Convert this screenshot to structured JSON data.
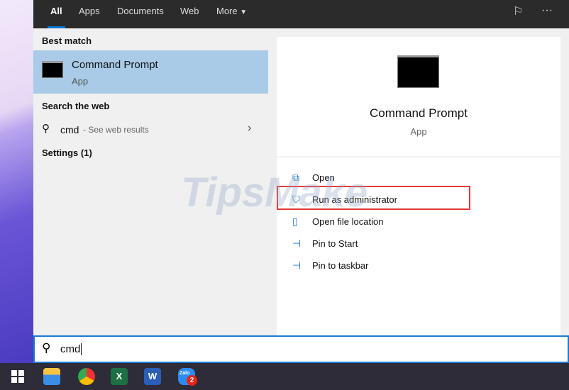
{
  "tabs": [
    {
      "label": "All",
      "active": true
    },
    {
      "label": "Apps"
    },
    {
      "label": "Documents"
    },
    {
      "label": "Web"
    },
    {
      "label": "More"
    }
  ],
  "left": {
    "best_match_header": "Best match",
    "best_match": {
      "title": "Command Prompt",
      "subtitle": "App"
    },
    "web_header": "Search the web",
    "web_item": {
      "query": "cmd",
      "suffix": "- See web results"
    },
    "settings_header": "Settings (1)"
  },
  "preview": {
    "title": "Command Prompt",
    "subtitle": "App"
  },
  "actions": [
    {
      "label": "Open",
      "icon": "open-icon"
    },
    {
      "label": "Run as administrator",
      "icon": "shield-icon",
      "highlighted": true
    },
    {
      "label": "Open file location",
      "icon": "file-location-icon"
    },
    {
      "label": "Pin to Start",
      "icon": "pin-icon"
    },
    {
      "label": "Pin to taskbar",
      "icon": "pin-icon"
    }
  ],
  "search": {
    "value": "cmd"
  },
  "taskbar": {
    "zalo_badge": "2",
    "zalo_label": "Zalo"
  },
  "watermark": "TipsMake.com",
  "colors": {
    "accent": "#0078d7",
    "highlight_border": "#e53935",
    "selected": "#a9cbe7"
  }
}
